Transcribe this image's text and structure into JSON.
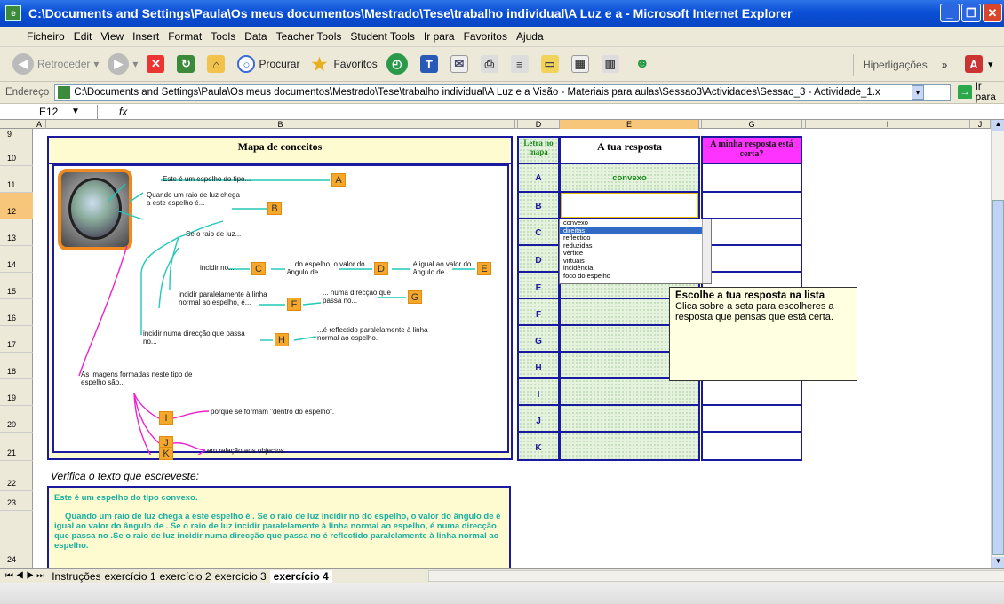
{
  "window": {
    "title": "C:\\Documents and Settings\\Paula\\Os meus documentos\\Mestrado\\Tese\\trabalho individual\\A Luz e a  - Microsoft Internet Explorer"
  },
  "menu": [
    "Ficheiro",
    "Edit",
    "View",
    "Insert",
    "Format",
    "Tools",
    "Data",
    "Teacher Tools",
    "Student Tools",
    "Ir para",
    "Favoritos",
    "Ajuda"
  ],
  "toolbar": {
    "back": "Retroceder",
    "search": "Procurar",
    "favorites": "Favoritos",
    "links": "Hiperligações"
  },
  "address": {
    "label": "Endereço",
    "url": "C:\\Documents and Settings\\Paula\\Os meus documentos\\Mestrado\\Tese\\trabalho individual\\A Luz e a Visão - Materiais para aulas\\Sessao3\\Actividades\\Sessao_3 - Actividade_1.x",
    "go": "Ir para"
  },
  "namebox": "E12",
  "fx": "fx",
  "columns": [
    "A",
    "B",
    "C",
    "D",
    "E",
    "F",
    "G",
    "H",
    "I",
    "J"
  ],
  "rows": [
    "9",
    "10",
    "11",
    "12",
    "13",
    "14",
    "15",
    "16",
    "17",
    "18",
    "19",
    "20",
    "21",
    "22",
    "23",
    "24"
  ],
  "map": {
    "title": "Mapa de conceitos",
    "labels": {
      "l1": "Este é um espelho do tipo...",
      "l2": "Quando um raio de luz chega a este espelho é...",
      "l3": "Se o raio de luz...",
      "l4": "incidir no...",
      "l5": "... do espelho, o valor do ângulo de..",
      "l6": "é igual ao valor do ângulo de...",
      "l7": "incidir paralelamente à linha normal ao espelho, é...",
      "l8": "... numa direcção que passa no...",
      "l9": "incidir numa direcção que passa no...",
      "l10": "...é reflectido paralelamente à linha normal ao espelho.",
      "l11": "As imagens formadas neste tipo de espelho são...",
      "l12": "porque se formam \"dentro do espelho\".",
      "l13": "em relação aos objectos."
    },
    "letters": [
      "A",
      "B",
      "C",
      "D",
      "E",
      "F",
      "G",
      "H",
      "I",
      "J",
      "K"
    ]
  },
  "answers": {
    "col_letter": "Letra no mapa",
    "col_answer": "A tua resposta",
    "col_check": "A minha resposta está certa?",
    "rows": [
      "A",
      "B",
      "C",
      "D",
      "E",
      "F",
      "G",
      "H",
      "I",
      "J",
      "K"
    ],
    "A_value": "convexo"
  },
  "dropdown": {
    "options": [
      "convexo",
      "direitas",
      "reflectido",
      "reduzidas",
      "vértice",
      "virtuais",
      "incidência",
      "foco do espelho"
    ],
    "selected": "direitas"
  },
  "tooltip": {
    "title": "Escolhe a tua resposta na lista",
    "body": "Clica sobre a seta para escolheres a resposta  que pensas que está certa."
  },
  "verify": {
    "heading": "Verifica o texto que escreveste:",
    "p1": "Este é um espelho do tipo convexo.",
    "p2": "Quando um raio de luz chega a este espelho é . Se o raio de luz incidir no  do espelho, o valor do ângulo de   é igual ao valor do ângulo de . Se o raio de luz incidir paralelamente à linha normal ao espelho, é  numa direcção que passa no .Se o raio de luz incidir numa direcção que passa no  é reflectido paralelamente à linha normal ao espelho."
  },
  "sheets": [
    "Instruções",
    "exercício 1",
    "exercício 2",
    "exercício 3",
    "exercício 4"
  ],
  "active_sheet": "exercício 4",
  "colors": {
    "title_blue": "#0a4fd6",
    "cell_border": "#1a1aa0",
    "answer_green": "#1a8a1a",
    "check_magenta": "#ff33ff",
    "verify_teal": "#19b0a0",
    "box_orange": "#f7a82a"
  }
}
